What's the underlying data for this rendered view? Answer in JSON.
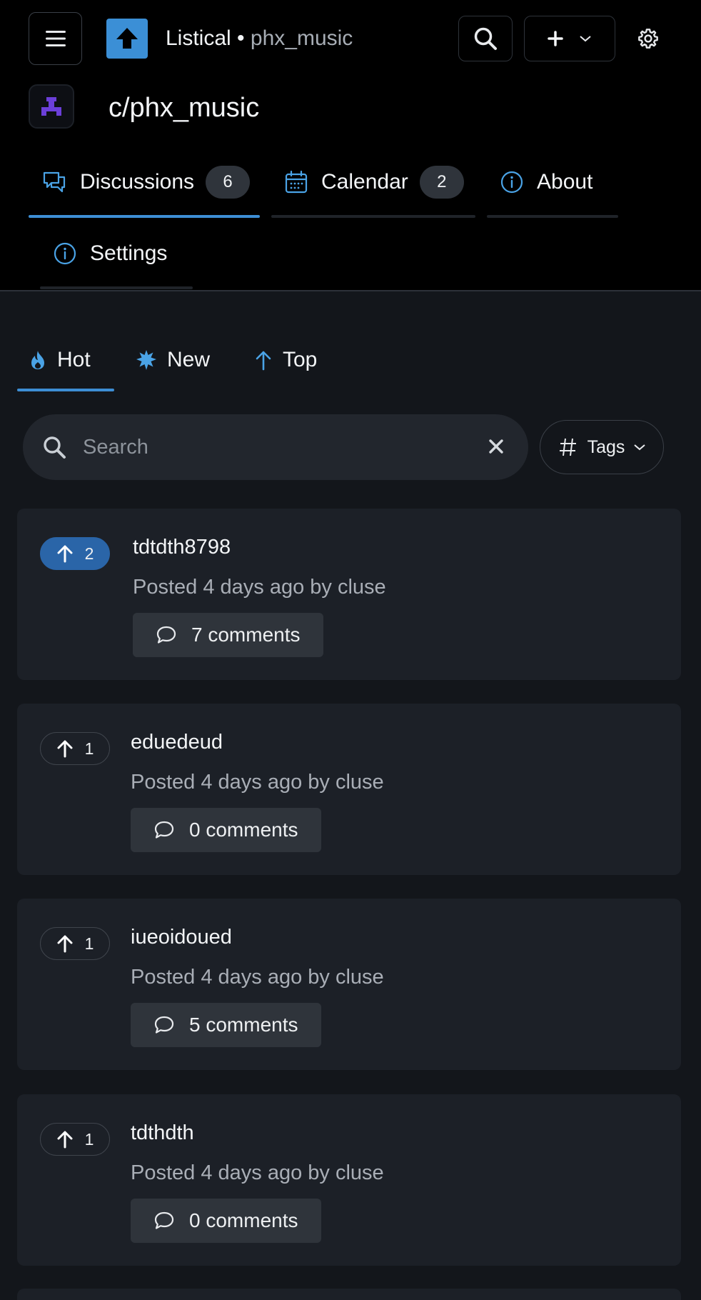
{
  "header": {
    "app_name": "Listical",
    "separator": "•",
    "community_slug": "phx_music",
    "icons": {
      "menu": "hamburger-icon",
      "logo": "upvote-arrow-logo",
      "search": "search-icon",
      "create": "plus-icon",
      "create_menu": "chevron-down-icon",
      "settings": "gear-icon"
    }
  },
  "community": {
    "title": "c/phx_music",
    "avatar_icon": "community-glyph-icon"
  },
  "tabs": [
    {
      "label": "Discussions",
      "count": "6",
      "icon": "chat-bubbles-icon",
      "active": true
    },
    {
      "label": "Calendar",
      "count": "2",
      "icon": "calendar-icon",
      "active": false
    },
    {
      "label": "About",
      "icon": "info-icon",
      "active": false
    },
    {
      "label": "Settings",
      "icon": "info-icon",
      "active": false
    }
  ],
  "sort_tabs": [
    {
      "label": "Hot",
      "icon": "flame-icon",
      "active": true
    },
    {
      "label": "New",
      "icon": "sparkle-icon",
      "active": false
    },
    {
      "label": "Top",
      "icon": "arrow-up-icon",
      "active": false
    }
  ],
  "search": {
    "placeholder": "Search",
    "value": "",
    "clear_icon": "close-icon"
  },
  "tags_filter": {
    "label": "Tags",
    "icon": "hash-icon"
  },
  "posts": [
    {
      "votes": "2",
      "voted": true,
      "title": "tdtdth8798",
      "meta": "Posted 4 days ago by cluse",
      "comments": "7 comments"
    },
    {
      "votes": "1",
      "voted": false,
      "title": "eduedeud",
      "meta": "Posted 4 days ago by cluse",
      "comments": "0 comments"
    },
    {
      "votes": "1",
      "voted": false,
      "title": "iueoidoued",
      "meta": "Posted 4 days ago by cluse",
      "comments": "5 comments"
    },
    {
      "votes": "1",
      "voted": false,
      "title": "tdthdth",
      "meta": "Posted 4 days ago by cluse",
      "comments": "0 comments"
    }
  ],
  "colors": {
    "accent": "#3d8ed4",
    "voted": "#2a65a8",
    "header_bg": "#000000",
    "page_bg": "#13161b",
    "card_bg": "#1c2027",
    "avatar_purple": "#6b3fd8"
  }
}
